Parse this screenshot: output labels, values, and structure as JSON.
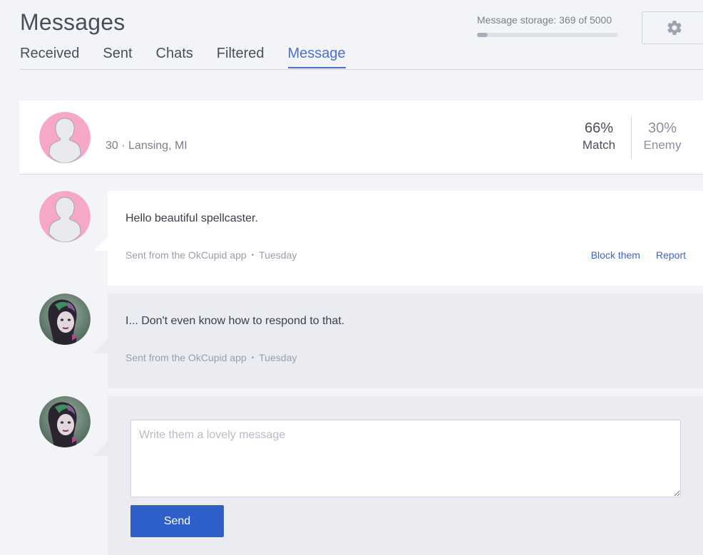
{
  "header": {
    "title": "Messages",
    "storage_label": "Message storage: 369 of 5000",
    "storage_used": 369,
    "storage_total": 5000,
    "settings_icon": "gear-icon"
  },
  "tabs": [
    {
      "label": "Received",
      "active": false
    },
    {
      "label": "Sent",
      "active": false
    },
    {
      "label": "Chats",
      "active": false
    },
    {
      "label": "Filtered",
      "active": false
    },
    {
      "label": "Message",
      "active": true
    }
  ],
  "profile": {
    "info": "30 · Lansing, MI",
    "match_value": "66%",
    "match_label": "Match",
    "enemy_value": "30%",
    "enemy_label": "Enemy"
  },
  "messages": [
    {
      "text": "Hello beautiful spellcaster.",
      "source": "Sent from the OkCupid app",
      "separator": "•",
      "day": "Tuesday",
      "block_label": "Block them",
      "report_label": "Report"
    },
    {
      "text": "I... Don't even know how to respond to that.",
      "source": "Sent from the OkCupid app",
      "separator": "•",
      "day": "Tuesday"
    }
  ],
  "compose": {
    "placeholder": "Write them a lovely message",
    "value": "",
    "send_label": "Send"
  },
  "colors": {
    "accent": "#4b6fd1",
    "send_button": "#2f5fc8",
    "default_avatar_bg": "#f7a8c8"
  }
}
